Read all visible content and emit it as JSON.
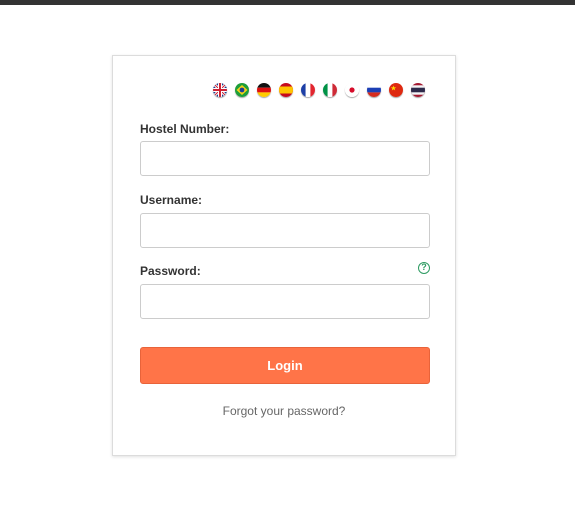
{
  "languages": [
    {
      "icon": "uk-flag-icon"
    },
    {
      "icon": "brazil-flag-icon"
    },
    {
      "icon": "germany-flag-icon"
    },
    {
      "icon": "spain-flag-icon"
    },
    {
      "icon": "france-flag-icon"
    },
    {
      "icon": "italy-flag-icon"
    },
    {
      "icon": "japan-flag-icon"
    },
    {
      "icon": "russia-flag-icon"
    },
    {
      "icon": "china-flag-icon"
    },
    {
      "icon": "thailand-flag-icon"
    }
  ],
  "form": {
    "hostel_number_label": "Hostel Number:",
    "hostel_number_value": "",
    "username_label": "Username:",
    "username_value": "",
    "password_label": "Password:",
    "password_value": "",
    "password_help_icon": "question-circle-icon",
    "login_label": "Login",
    "forgot_link": "Forgot your password?"
  },
  "colors": {
    "top_bar": "#333333",
    "login_button": "#ff7448",
    "help_icon": "#2e9b62",
    "link": "#666666"
  }
}
